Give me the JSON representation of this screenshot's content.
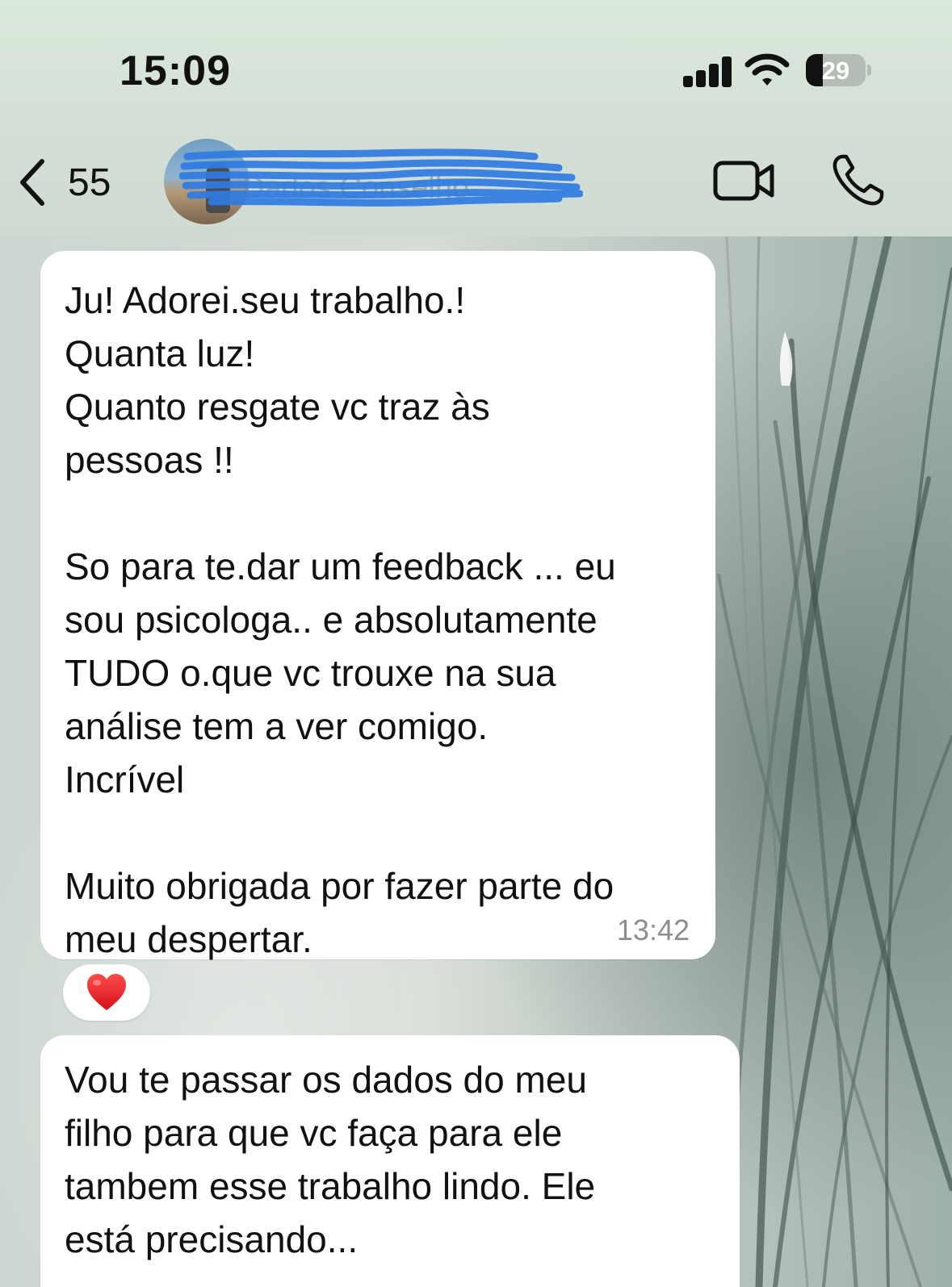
{
  "status_bar": {
    "time": "15:09",
    "battery": "29",
    "battery_level": 0.29,
    "signal_bars": 4,
    "icons": [
      "signal-icon",
      "wifi-icon",
      "battery-icon"
    ]
  },
  "header": {
    "back_count": "55",
    "contact_name": "Dados Conselho",
    "contact_name_redacted": true,
    "icons": [
      "back-chevron-icon",
      "video-call-icon",
      "phone-icon"
    ]
  },
  "messages": [
    {
      "lines": [
        "Ju! Adorei.seu trabalho.!",
        "Quanta luz!",
        "Quanto resgate vc traz às",
        "pessoas !!",
        "",
        "So para te.dar um feedback ... eu",
        "sou psicologa.. e absolutamente",
        "TUDO o.que vc trouxe na sua",
        "análise tem a ver comigo.",
        "Incrível",
        "",
        "Muito obrigada por fazer parte do",
        "meu despertar."
      ],
      "time": "13:42",
      "reaction": "❤️"
    },
    {
      "lines": [
        "Vou te passar os dados do meu",
        "filho para que vc faça para ele",
        "tambem esse trabalho lindo. Ele",
        "está precisando..."
      ]
    }
  ],
  "colors": {
    "bubble": "#ffffff",
    "header_bg": "#d6e3d8",
    "timestamp": "#8b8f8d",
    "redaction_scribble": "#2f7be3"
  }
}
